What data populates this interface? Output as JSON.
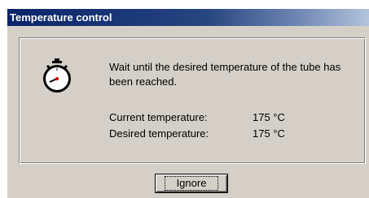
{
  "window": {
    "title": "Temperature control"
  },
  "message": "Wait until the desired temperature of the tube has been reached.",
  "current": {
    "label": "Current temperature:",
    "value": "175 °C"
  },
  "desired": {
    "label": "Desired temperature:",
    "value": "175 °C"
  },
  "buttons": {
    "ignore_label": "Ignore"
  },
  "icon": "stopwatch-icon"
}
